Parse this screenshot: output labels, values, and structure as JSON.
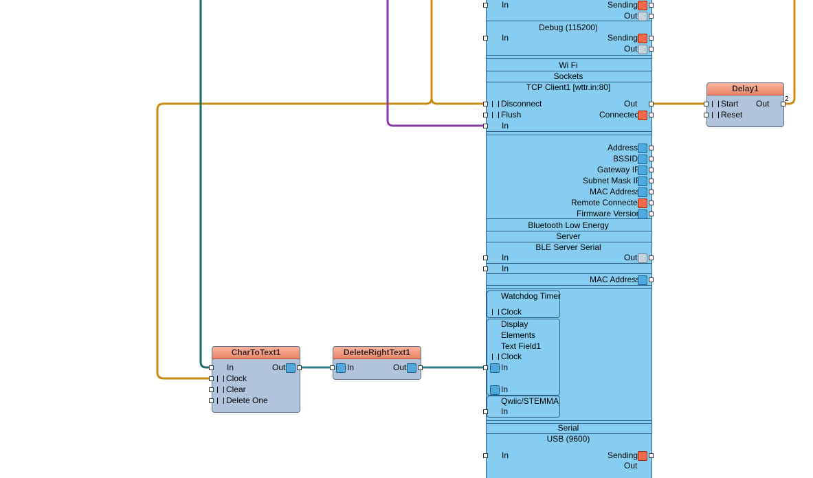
{
  "wires": {
    "orange": "#c98a12",
    "teal": "#1d6b6b",
    "purple": "#8a3aa8",
    "teal_data": "#2a7f88"
  },
  "board": {
    "top_rows": [
      {
        "left": "In",
        "right": "Sending",
        "right2": "Out"
      }
    ],
    "debug": {
      "title": "Debug (115200)",
      "in": "In",
      "sending": "Sending",
      "out": "Out"
    },
    "wifi": {
      "title": "Wi Fi",
      "sockets": "Sockets",
      "tcp_title": "TCP Client1 [wttr.in:80]",
      "disconnect": "Disconnect",
      "flush": "Flush",
      "in": "In",
      "out": "Out",
      "connected": "Connected",
      "address": "Address",
      "bssid": "BSSID",
      "gateway": "Gateway IP",
      "subnet": "Subnet Mask IP",
      "mac": "MAC Address",
      "remote": "Remote Connected",
      "firmware": "Firmware Version"
    },
    "ble": {
      "title": "Bluetooth Low Energy",
      "server": "Server",
      "serial": "BLE Server Serial",
      "in1": "In",
      "in2": "In",
      "out": "Out",
      "mac": "MAC Address"
    },
    "watchdog": {
      "title": "Watchdog Timer",
      "clock": "Clock"
    },
    "display": {
      "title": "Display",
      "elements": "Elements",
      "text_field": "Text Field1",
      "clock": "Clock",
      "in1": "In",
      "in2": "In"
    },
    "qwiic": {
      "title": "Qwiic/STEMMA",
      "in": "In"
    },
    "serial": {
      "title": "Serial",
      "usb": "USB (9600)",
      "in": "In",
      "sending": "Sending",
      "out": "Out"
    }
  },
  "delay": {
    "title": "Delay1",
    "start": "Start",
    "reset": "Reset",
    "out": "Out",
    "pin_num": "2"
  },
  "chartotext": {
    "title": "CharToText1",
    "in": "In",
    "clock": "Clock",
    "clear": "Clear",
    "delete_one": "Delete One",
    "out": "Out"
  },
  "deleteright": {
    "title": "DeleteRightText1",
    "in": "In",
    "out": "Out"
  }
}
